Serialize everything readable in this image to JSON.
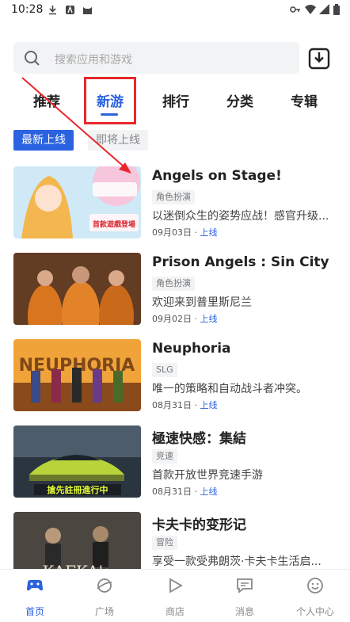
{
  "status_bar": {
    "time": "10:28"
  },
  "search": {
    "placeholder": "搜索应用和游戏"
  },
  "tabs": [
    {
      "label": "推荐"
    },
    {
      "label": "新游"
    },
    {
      "label": "排行"
    },
    {
      "label": "分类"
    },
    {
      "label": "专辑"
    }
  ],
  "active_tab": "新游",
  "filters": {
    "latest": "最新上线",
    "upcoming": "即将上线"
  },
  "games": [
    {
      "title": "Angels on Stage!",
      "tag": "角色扮演",
      "desc": "以迷倒众生的姿势应战！感官升级...",
      "date": "09月03日",
      "status": "上线",
      "thumb_text": "首款遊戲登場"
    },
    {
      "title": "Prison Angels : Sin City",
      "tag": "角色扮演",
      "desc": "欢迎来到普里斯尼兰",
      "date": "09月02日",
      "status": "上线"
    },
    {
      "title": "Neuphoria",
      "tag": "SLG",
      "desc": "唯一的策略和自动战斗者冲突。",
      "date": "08月31日",
      "status": "上线",
      "thumb_text": "NEUPHORIA"
    },
    {
      "title": "極速快感：集結",
      "tag": "竞速",
      "desc": "首款开放世界竞速手游",
      "date": "08月31日",
      "status": "上线",
      "thumb_text": "搶先註冊進行中"
    },
    {
      "title": "卡夫卡的变形记",
      "tag": "冒险",
      "desc": "享受一款受弗朗茨·卡夫卡生活启...",
      "date": "",
      "status": "",
      "thumb_text": "KAFKA's"
    }
  ],
  "bottom_nav": [
    {
      "label": "首页",
      "icon": "gamepad-icon"
    },
    {
      "label": "广场",
      "icon": "planet-icon"
    },
    {
      "label": "商店",
      "icon": "play-icon"
    },
    {
      "label": "消息",
      "icon": "chat-icon"
    },
    {
      "label": "个人中心",
      "icon": "smiley-icon"
    }
  ],
  "colors": {
    "accent": "#2a62e0",
    "annotation": "#e8272c"
  }
}
